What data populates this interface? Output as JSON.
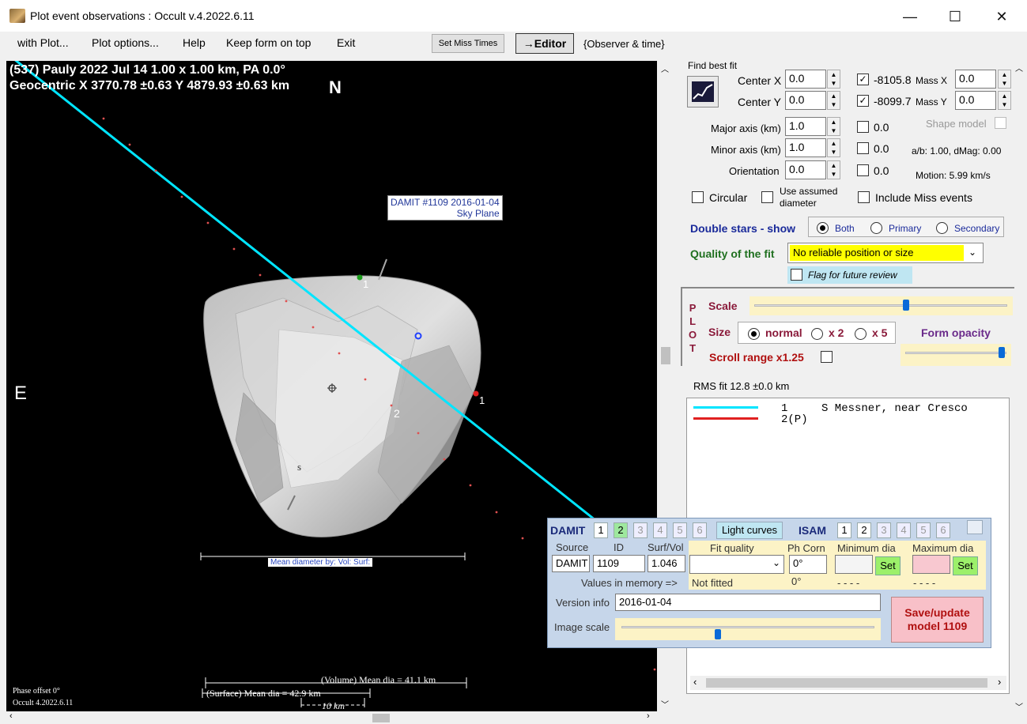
{
  "window": {
    "title": "Plot event observations : Occult v.4.2022.6.11",
    "minimize": "—",
    "maximize": "☐",
    "close": "✕"
  },
  "menu": {
    "items": [
      "with Plot...",
      "Plot options...",
      "Help",
      "Keep form on top",
      "Exit"
    ],
    "set_miss_times": "Set Miss Times",
    "editor": "→Editor",
    "observer_time": "{Observer & time}"
  },
  "plot": {
    "header1": "(537) Pauly  2022 Jul 14   1.00 x 1.00 km, PA 0.0°",
    "header2": "Geocentric  X  3770.78 ±0.63  Y 4879.93 ±0.63 km",
    "north": "N",
    "east": "E",
    "damit_label1": "DAMIT #1109 2016-01-04",
    "damit_label2": "Sky Plane",
    "chord1_a": "1",
    "chord1_b": "1",
    "chord2": "2",
    "s_label": "s",
    "mean_dia_by": "Mean diameter by:  Vol:  Surf:",
    "volume_dia": "(Volume) Mean dia = 41.1 km",
    "surface_dia": "(Surface) Mean dia = 42.9 km",
    "scale_bar": "10 km",
    "phase_offset": "Phase offset 0°",
    "version": "Occult 4.2022.6.11"
  },
  "fit": {
    "find_best_fit": "Find best fit",
    "center_x_label": "Center X",
    "center_x": "0.0",
    "center_y_label": "Center Y",
    "center_y": "0.0",
    "chk_x_val": "-8105.8",
    "chk_y_val": "-8099.7",
    "mass_x_label": "Mass X",
    "mass_x": "0.0",
    "mass_y_label": "Mass Y",
    "mass_y": "0.0",
    "major_label": "Major axis (km)",
    "major": "1.0",
    "major_chk": "0.0",
    "minor_label": "Minor axis (km)",
    "minor": "1.0",
    "minor_chk": "0.0",
    "orient_label": "Orientation",
    "orient": "0.0",
    "orient_chk": "0.0",
    "shape_model": "Shape model",
    "ab_dmag": "a/b: 1.00, dMag: 0.00",
    "motion": "Motion: 5.99 km/s",
    "circular": "Circular",
    "use_assumed": "Use assumed",
    "diameter": "diameter",
    "include_miss": "Include Miss events",
    "double_stars": "Double stars - show",
    "both": "Both",
    "primary": "Primary",
    "secondary": "Secondary",
    "quality_label": "Quality of the fit",
    "quality_value": "No reliable position or size",
    "flag_review": "Flag for future review"
  },
  "plotpanel": {
    "letters": [
      "P",
      "L",
      "O",
      "T"
    ],
    "scale": "Scale",
    "size": "Size",
    "normal": "normal",
    "x2": "x 2",
    "x5": "x 5",
    "form_opacity": "Form opacity",
    "scroll_range": "Scroll range x1.25",
    "scale_level": 0.6,
    "opacity_level": 0.95
  },
  "rms": {
    "text": "RMS fit 12.8 ±0.0 km",
    "row1_num": "1",
    "row1_text": "S Messner, near Cresco",
    "row2": "2(P)",
    "colors": {
      "row1": "#00e5ff",
      "row2": "#e02020"
    }
  },
  "damit": {
    "damit_label": "DAMIT",
    "tabs": [
      "1",
      "2",
      "3",
      "4",
      "5",
      "6"
    ],
    "light_curves": "Light curves",
    "isam_label": "ISAM",
    "isam_tabs": [
      "1",
      "2",
      "3",
      "4",
      "5",
      "6"
    ],
    "source_label": "Source",
    "id_label": "ID",
    "surfvol_label": "Surf/Vol",
    "source": "DAMIT",
    "id": "1109",
    "surfvol": "1.046",
    "fit_quality": "Fit quality",
    "ph_corr": "Ph Corn",
    "min_dia": "Minimum dia",
    "max_dia": "Maximum dia",
    "ph_corr_val": "0°",
    "set": "Set",
    "values_in_memory": "Values in memory =>",
    "not_fitted": "Not fitted",
    "ph_mem": "0°",
    "dash1": "- - - -",
    "dash2": "- - - -",
    "version_info": "Version info",
    "version_val": "2016-01-04",
    "image_scale": "Image scale",
    "image_scale_level": 0.38,
    "save_update": "Save/update",
    "model": "model 1109"
  }
}
